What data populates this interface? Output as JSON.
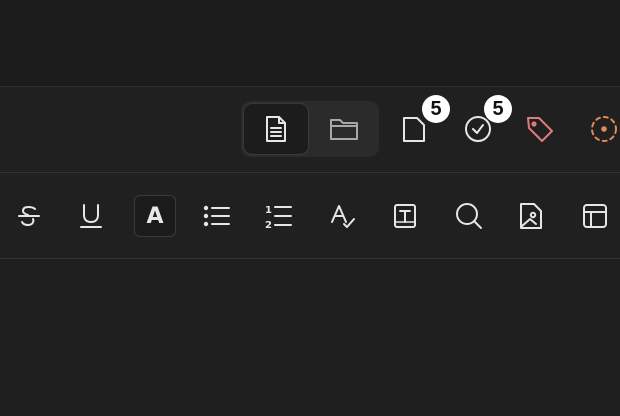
{
  "toolbar": {
    "view_toggle": {
      "options": [
        {
          "name": "document-view",
          "icon": "document-icon",
          "active": true
        },
        {
          "name": "folder-view",
          "icon": "folder-icon",
          "active": false
        }
      ]
    },
    "pages_badge": "5",
    "tasks_badge": "5",
    "tag_color": "#e07b7b",
    "lasso_color": "#e08a5a"
  },
  "format_toolbar": {
    "tools": [
      {
        "name": "strikethrough",
        "icon": "strikethrough-icon"
      },
      {
        "name": "underline",
        "icon": "underline-icon"
      },
      {
        "name": "font",
        "label": "A",
        "icon": "font-icon",
        "active": true
      },
      {
        "name": "bulleted-list",
        "icon": "bulleted-list-icon"
      },
      {
        "name": "numbered-list",
        "icon": "numbered-list-icon"
      },
      {
        "name": "spellcheck",
        "icon": "spellcheck-icon"
      },
      {
        "name": "text-box",
        "icon": "text-box-icon"
      },
      {
        "name": "search",
        "icon": "search-icon"
      },
      {
        "name": "image",
        "icon": "image-icon"
      },
      {
        "name": "table",
        "icon": "table-icon"
      }
    ]
  }
}
